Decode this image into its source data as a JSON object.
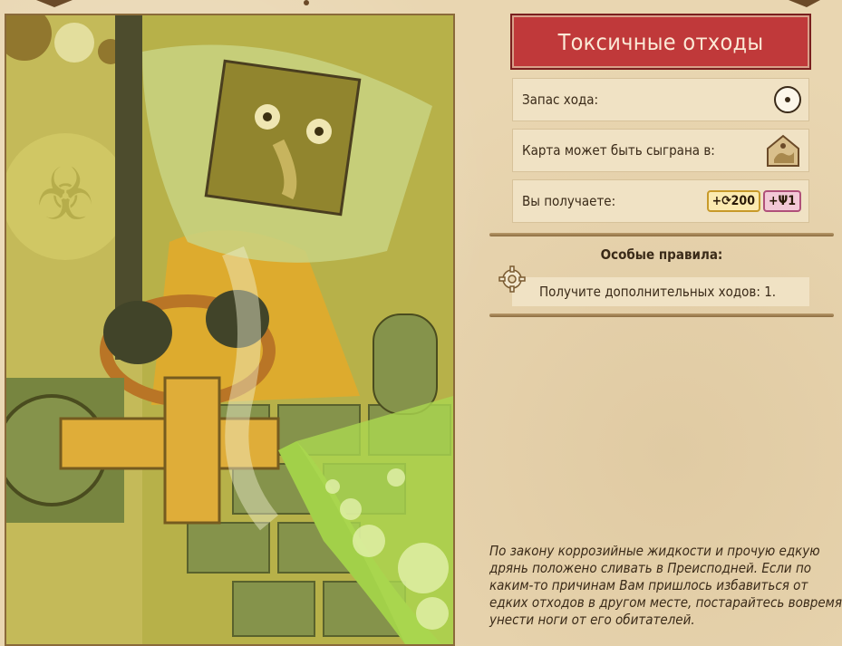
{
  "card": {
    "title": "Токсичные отходы",
    "move_label": "Запас хода:",
    "playable_label": "Карта может быть сыграна в:",
    "reward_label": "Вы получаете:",
    "reward_gold": "+⟳200",
    "reward_pink": "+Ψ1",
    "special_rules_title": "Особые правила:",
    "special_rule": "Получите дополнительных ходов: 1.",
    "flavor_text": "По закону коррозийные жидкости и прочую едкую дрянь положено сливать в Преисподней. Если по каким-то причинам Вам пришлось избавиться от едких отходов в другом месте, постарайтесь вовремя унести ноги от его обитателей."
  },
  "icons": {
    "move": "dot-circle-icon",
    "location": "house-icon",
    "rule": "gear-icon"
  },
  "colors": {
    "title_bg": "#c0393a",
    "gold_chip": "#fbeab0",
    "pink_chip": "#f2c8d6"
  }
}
